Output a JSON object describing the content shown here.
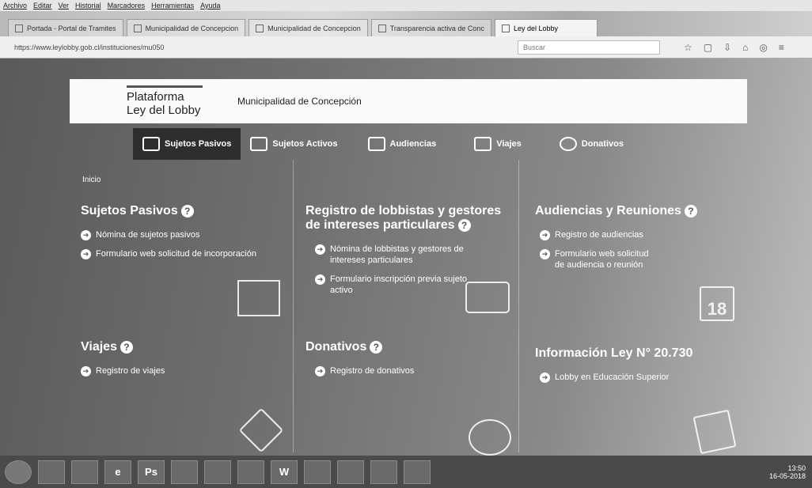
{
  "menubar": [
    "Archivo",
    "Editar",
    "Ver",
    "Historial",
    "Marcadores",
    "Herramientas",
    "Ayuda"
  ],
  "tabs": [
    {
      "label": "Portada - Portal de Tramites"
    },
    {
      "label": "Municipalidad de Concepcion"
    },
    {
      "label": "Municipalidad de Concepcion"
    },
    {
      "label": "Transparencia activa de Conc"
    },
    {
      "label": "Ley del Lobby",
      "active": true
    }
  ],
  "address": {
    "url": "https://www.leylobby.gob.cl/instituciones/mu050",
    "search_placeholder": "Buscar"
  },
  "banner": {
    "brand_line1": "Plataforma",
    "brand_line2": "Ley del Lobby",
    "institution": "Municipalidad de Concepción"
  },
  "nav": [
    {
      "label": "Sujetos Pasivos",
      "active": true
    },
    {
      "label": "Sujetos Activos"
    },
    {
      "label": "Audiencias"
    },
    {
      "label": "Viajes"
    },
    {
      "label": "Donativos"
    }
  ],
  "breadcrumb": "Inicio",
  "sections": {
    "sujetos_pasivos": {
      "title": "Sujetos Pasivos",
      "links": [
        "Nómina de sujetos pasivos",
        "Formulario web solicitud de incorporación"
      ]
    },
    "registro": {
      "title": "Registro de lobbistas y gestores de intereses particulares",
      "links": [
        "Nómina de lobbistas y gestores de intereses particulares",
        "Formulario inscripción previa sujeto activo"
      ]
    },
    "audiencias": {
      "title": "Audiencias y Reuniones",
      "links": [
        "Registro de audiencias",
        "Formulario web solicitud de audiencia o reunión"
      ]
    },
    "viajes": {
      "title": "Viajes",
      "links": [
        "Registro de viajes"
      ]
    },
    "donativos": {
      "title": "Donativos",
      "links": [
        "Registro de donativos"
      ]
    },
    "informacion": {
      "title": "Información Ley N° 20.730",
      "links": [
        "Lobby en Educación Superior"
      ]
    }
  },
  "calendar_number": "18",
  "taskbar": {
    "apps": [
      "",
      "",
      "",
      "e",
      "Ps",
      "",
      "",
      "",
      "W",
      "",
      "",
      "",
      ""
    ],
    "time": "13:50",
    "date": "16-05-2018"
  }
}
